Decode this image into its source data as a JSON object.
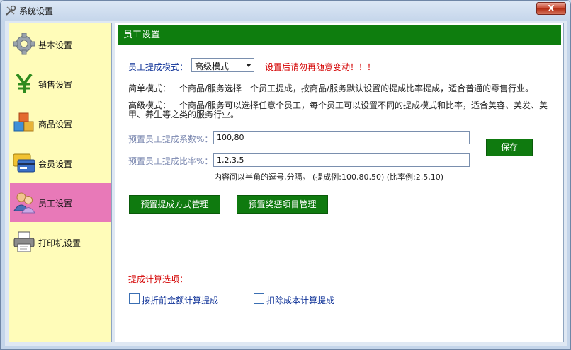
{
  "window": {
    "title": "系统设置",
    "close_label": "X"
  },
  "sidebar": {
    "items": [
      {
        "label": "基本设置",
        "icon": "gear-icon"
      },
      {
        "label": "销售设置",
        "icon": "yen-icon"
      },
      {
        "label": "商品设置",
        "icon": "boxes-icon"
      },
      {
        "label": "会员设置",
        "icon": "card-icon"
      },
      {
        "label": "员工设置",
        "icon": "staff-icon",
        "active": true
      },
      {
        "label": "打印机设置",
        "icon": "printer-icon"
      }
    ]
  },
  "panel": {
    "title": "员工设置",
    "mode_label": "员工提成模式：",
    "mode_value": "高级模式",
    "mode_warning": "设置后请勿再随意变动！！！",
    "simple_desc": "简单模式：一个商品/服务选择一个员工提成，按商品/服务默认设置的提成比率提成，适合普通的零售行业。",
    "advanced_desc_line1": "高级模式：一个商品/服务可以选择任意个员工，每个员工可以设置不同的提成模式和比率，适合美容、美发、美",
    "advanced_desc_line2": "甲、养生等之类的服务行业。",
    "coef_label": "预置员工提成系数%：",
    "coef_value": "100,80",
    "ratio_label": "预置员工提成比率%：",
    "ratio_value": "1,2,3,5",
    "hint": "内容间以半角的逗号,分隔。 (提成例:100,80,50) (比率例:2,5,10)",
    "save_button": "保存",
    "manage_mode_button": "预置提成方式管理",
    "manage_reward_button": "预置奖惩项目管理",
    "calc_options_label": "提成计算选项：",
    "opt_discount": "按折前金额计算提成",
    "opt_cost": "扣除成本计算提成"
  },
  "colors": {
    "accent_green": "#0e7d0e",
    "sidebar_bg": "#fffcb9",
    "active_item": "#e879b8",
    "warning_red": "#d40000"
  }
}
